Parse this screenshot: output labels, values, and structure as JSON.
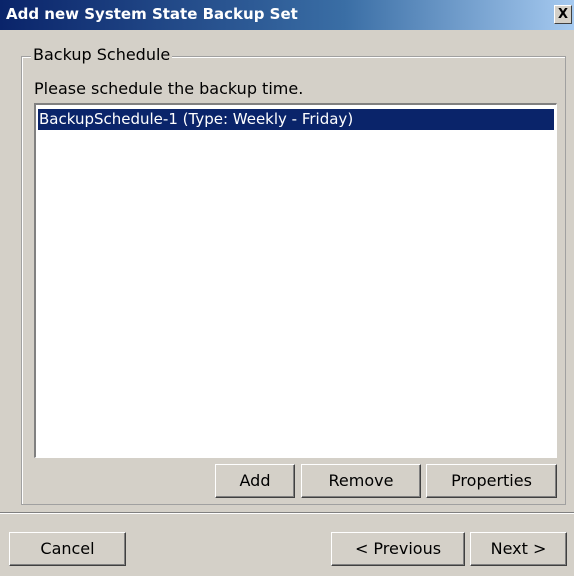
{
  "window": {
    "title": "Add new  System State Backup Set",
    "close_label": "X"
  },
  "group": {
    "legend": "Backup Schedule",
    "instruction": "Please schedule the backup time."
  },
  "schedule_list": {
    "items": [
      {
        "label": "BackupSchedule-1 (Type: Weekly - Friday)",
        "selected": true
      }
    ]
  },
  "list_buttons": {
    "add": "Add",
    "remove": "Remove",
    "properties": "Properties"
  },
  "footer": {
    "cancel": "Cancel",
    "previous": "< Previous",
    "next": "Next >"
  },
  "colors": {
    "face": "#d4d0c8",
    "selection": "#0a246a",
    "title_start": "#0a246a",
    "title_end": "#a6caf0"
  }
}
